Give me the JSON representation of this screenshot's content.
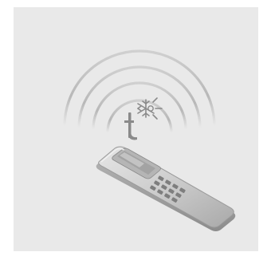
{
  "illustration": {
    "background_color": "#e9e9e9",
    "frame_color": "#ffffff",
    "arc_color": "#bdbdbd",
    "icon_color": "#8a8a8a",
    "remote_body_color": "#c8c8c8",
    "remote_edge_color": "#8f8f8f",
    "remote_screen_color": "#9a9a9a",
    "remote_button_color": "#7e7e7e",
    "icons": [
      "signal-waves-icon",
      "temperature-t-icon",
      "snowflake-sun-icon",
      "remote-control-icon"
    ]
  }
}
